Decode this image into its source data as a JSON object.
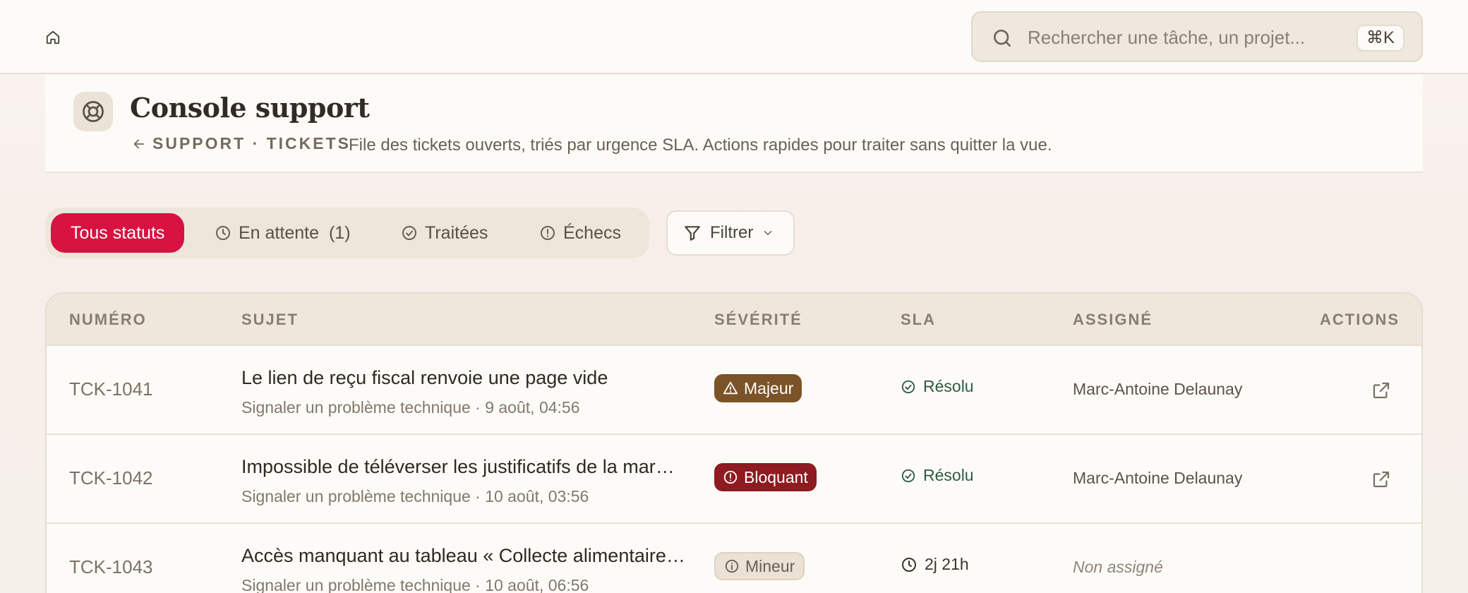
{
  "search": {
    "placeholder": "Rechercher une tâche, un projet...",
    "shortcut": "⌘K"
  },
  "header": {
    "title": "Console support",
    "breadcrumb": "SUPPORT · TICKETS",
    "subtitle": "File des tickets ouverts, triés par urgence SLA. Actions rapides pour traiter sans quitter la vue."
  },
  "tabs": {
    "all": "Tous statuts",
    "pending": "En attente",
    "pending_count": "(1)",
    "done": "Traitées",
    "failed": "Échecs"
  },
  "filter": {
    "label": "Filtrer"
  },
  "table": {
    "headers": {
      "number": "NUMÉRO",
      "subject": "SUJET",
      "severity": "SÉVÉRITÉ",
      "sla": "SLA",
      "assignee": "ASSIGNÉ",
      "actions": "ACTIONS"
    },
    "rows": [
      {
        "number": "TCK-1041",
        "title": "Le lien de reçu fiscal renvoie une page vide",
        "meta": "Signaler un problème technique · 9 août, 04:56",
        "severity": "Majeur",
        "sla": "Résolu",
        "assignee": "Marc-Antoine Delaunay"
      },
      {
        "number": "TCK-1042",
        "title": "Impossible de téléverser les justificatifs de la mar…",
        "meta": "Signaler un problème technique · 10 août, 03:56",
        "severity": "Bloquant",
        "sla": "Résolu",
        "assignee": "Marc-Antoine Delaunay"
      },
      {
        "number": "TCK-1043",
        "title": "Accès manquant au tableau « Collecte alimentaire…",
        "meta": "Signaler un problème technique · 10 août, 06:56",
        "severity": "Mineur",
        "sla": "2j 21h",
        "assignee": "Non assigné"
      }
    ]
  },
  "colors": {
    "accent": "#d81241",
    "badge_major": "#7c5327",
    "badge_blocking": "#8e1b1f",
    "badge_minor": "#ebe2d5",
    "sla_resolved": "#2f5a45",
    "sla_pending": "#3b342d"
  }
}
